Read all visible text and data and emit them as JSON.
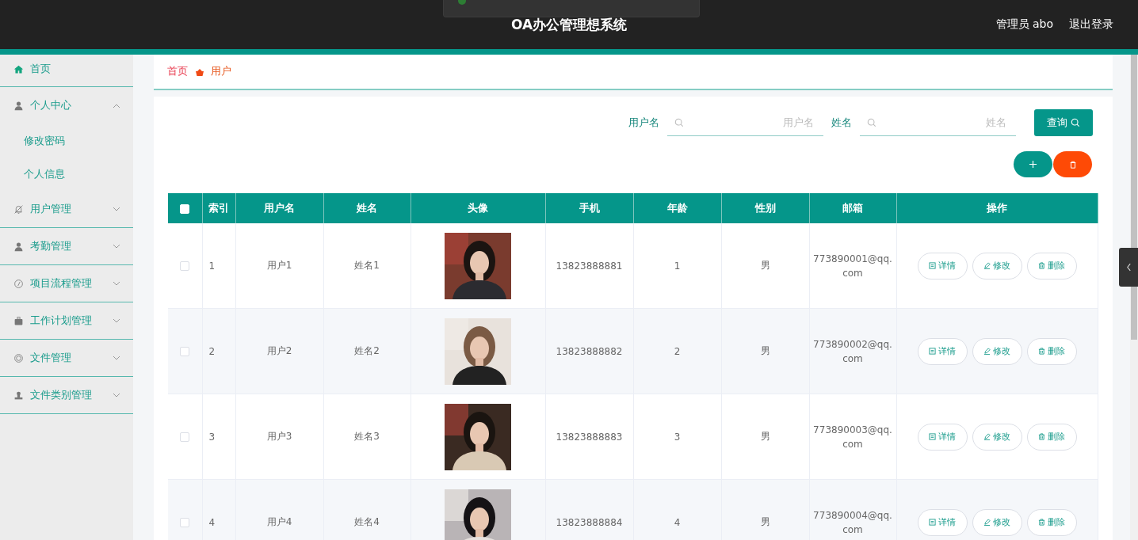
{
  "header": {
    "title": "OA办公管理想系统",
    "user": "管理员 abo",
    "logout": "退出登录"
  },
  "sidebar": {
    "items": [
      {
        "label": "首页"
      },
      {
        "label": "个人中心",
        "expanded": true,
        "children": [
          {
            "label": "修改密码"
          },
          {
            "label": "个人信息"
          }
        ]
      },
      {
        "label": "用户管理",
        "expanded": false
      },
      {
        "label": "考勤管理",
        "expanded": false
      },
      {
        "label": "项目流程管理",
        "expanded": false
      },
      {
        "label": "工作计划管理",
        "expanded": false
      },
      {
        "label": "文件管理",
        "expanded": false
      },
      {
        "label": "文件类别管理",
        "expanded": false
      }
    ]
  },
  "breadcrumb": [
    "首页",
    "用户"
  ],
  "search": {
    "fields": [
      {
        "label": "用户名",
        "placeholder": "用户名"
      },
      {
        "label": "姓名",
        "placeholder": "姓名"
      }
    ],
    "button": "查询"
  },
  "table": {
    "header_checked": false,
    "columns": [
      "索引",
      "用户名",
      "姓名",
      "头像",
      "手机",
      "年龄",
      "性别",
      "邮箱",
      "操作"
    ],
    "rows": [
      {
        "checked": false,
        "index": "1",
        "username": "用户1",
        "name": "姓名1",
        "avatar": {
          "kind": "picture"
        },
        "phone": "13823888881",
        "age": "1",
        "gender": "男",
        "email": "773890001@qq.com",
        "actions": [
          "详情",
          "修改",
          "删除"
        ]
      },
      {
        "checked": false,
        "index": "2",
        "username": "用户2",
        "name": "姓名2",
        "avatar": {
          "kind": "picture"
        },
        "phone": "13823888882",
        "age": "2",
        "gender": "男",
        "email": "773890002@qq.com",
        "actions": [
          "详情",
          "修改",
          "删除"
        ]
      },
      {
        "checked": false,
        "index": "3",
        "username": "用户3",
        "name": "姓名3",
        "avatar": {
          "kind": "picture"
        },
        "phone": "13823888883",
        "age": "3",
        "gender": "男",
        "email": "773890003@qq.com",
        "actions": [
          "详情",
          "修改",
          "删除"
        ]
      },
      {
        "checked": false,
        "index": "4",
        "username": "用户4",
        "name": "姓名4",
        "avatar": {
          "kind": "picture"
        },
        "phone": "13823888884",
        "age": "4",
        "gender": "男",
        "email": "773890004@qq.com",
        "actions": [
          "详情",
          "修改",
          "删除"
        ]
      }
    ]
  }
}
